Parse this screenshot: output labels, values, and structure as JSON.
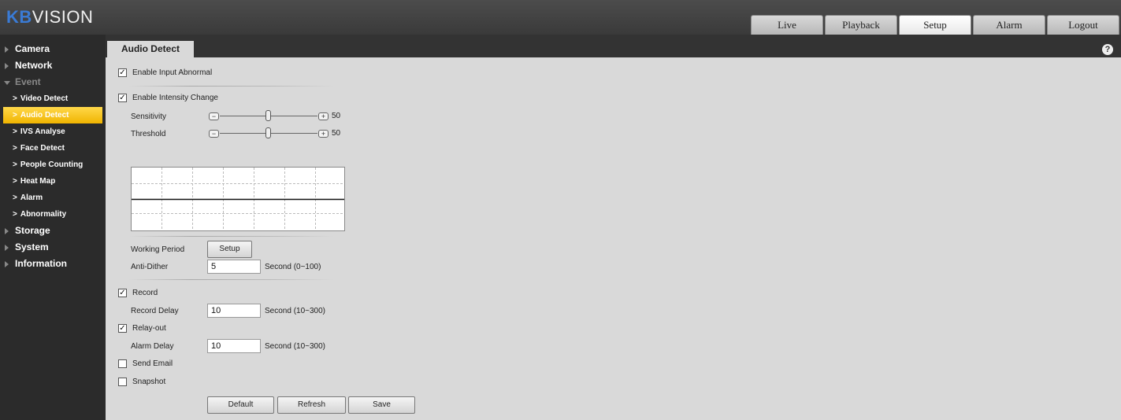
{
  "header": {
    "logo_kb": "KB",
    "logo_rest": "VISION",
    "tabs": [
      "Live",
      "Playback",
      "Setup",
      "Alarm",
      "Logout"
    ],
    "active_tab": "Setup"
  },
  "sidebar": {
    "camera": "Camera",
    "network": "Network",
    "event": "Event",
    "event_items": [
      "Video Detect",
      "Audio Detect",
      "IVS Analyse",
      "Face Detect",
      "People Counting",
      "Heat Map",
      "Alarm",
      "Abnormality"
    ],
    "active_event_item": "Audio Detect",
    "storage": "Storage",
    "system": "System",
    "information": "Information"
  },
  "page": {
    "tab_title": "Audio Detect",
    "help_glyph": "?",
    "enable_input_abnormal": "Enable Input Abnormal",
    "enable_intensity_change": "Enable Intensity Change",
    "sensitivity_label": "Sensitivity",
    "sensitivity_value": "50",
    "threshold_label": "Threshold",
    "threshold_value": "50",
    "working_period_label": "Working Period",
    "setup_button": "Setup",
    "anti_dither_label": "Anti-Dither",
    "anti_dither_value": "5",
    "anti_dither_unit": "Second (0~100)",
    "record_label": "Record",
    "record_delay_label": "Record Delay",
    "record_delay_value": "10",
    "record_delay_unit": "Second (10~300)",
    "relay_out_label": "Relay-out",
    "alarm_delay_label": "Alarm Delay",
    "alarm_delay_value": "10",
    "alarm_delay_unit": "Second (10~300)",
    "send_email_label": "Send Email",
    "snapshot_label": "Snapshot",
    "default_button": "Default",
    "refresh_button": "Refresh",
    "save_button": "Save",
    "checkbox_states": {
      "enable_input_abnormal": true,
      "enable_intensity_change": true,
      "record": true,
      "relay_out": true,
      "send_email": false,
      "snapshot": false
    },
    "checkmark": "✓",
    "slider_minus": "−",
    "slider_plus": "+"
  }
}
